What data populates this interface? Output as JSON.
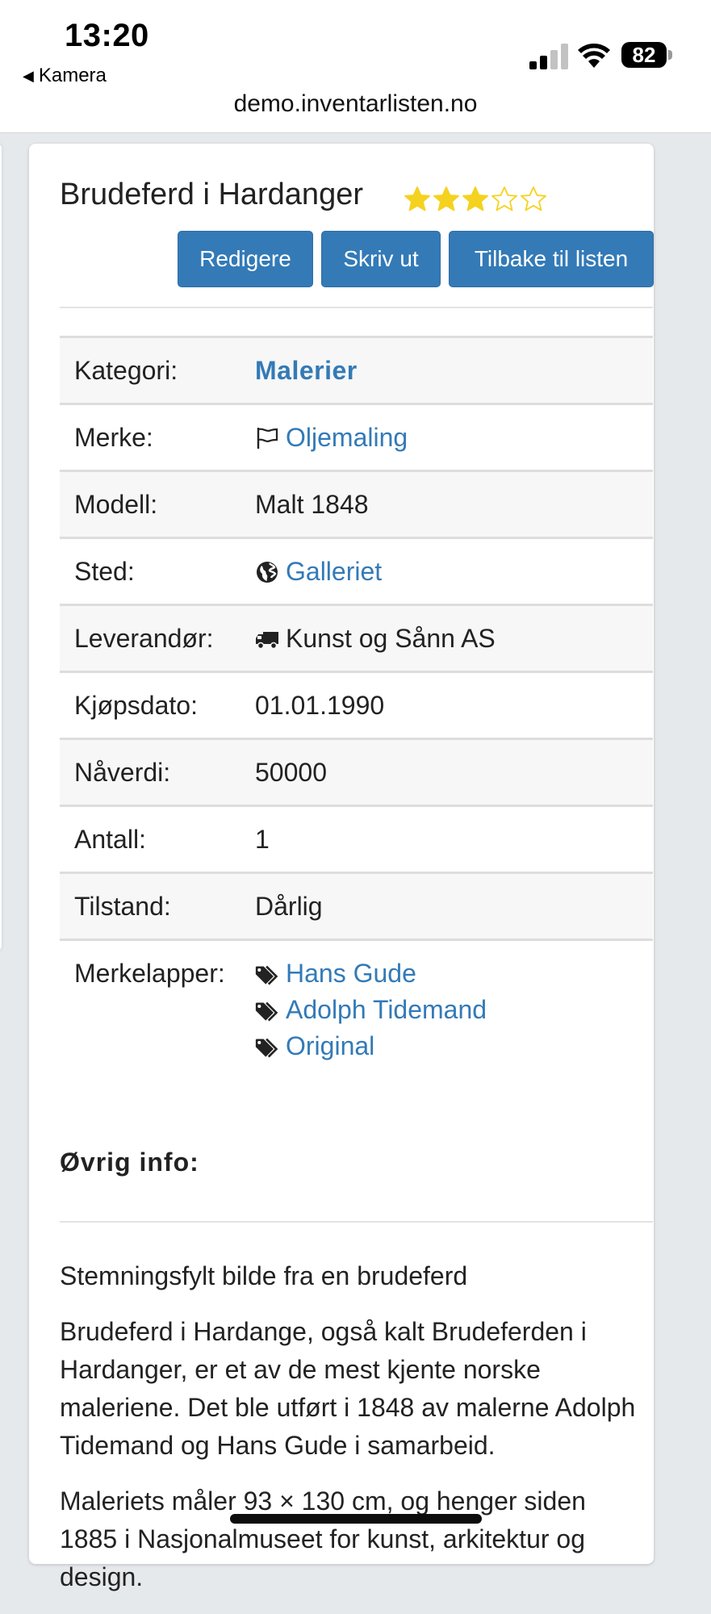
{
  "status": {
    "time": "13:20",
    "back_app": "Kamera",
    "battery": "82",
    "url": "demo.inventarlisten.no"
  },
  "item": {
    "title": "Brudeferd i Hardanger",
    "rating": 3,
    "rating_max": 5,
    "buttons": {
      "edit": "Redigere",
      "print": "Skriv ut",
      "back": "Tilbake til listen"
    },
    "fields": {
      "category": {
        "label": "Kategori:",
        "value": "Malerier"
      },
      "brand": {
        "label": "Merke:",
        "value": "Oljemaling",
        "icon": "flag-icon"
      },
      "model": {
        "label": "Modell:",
        "value": "Malt 1848"
      },
      "location": {
        "label": "Sted:",
        "value": "Galleriet",
        "icon": "globe-icon"
      },
      "supplier": {
        "label": "Leverandør:",
        "value": "Kunst og Sånn AS",
        "icon": "truck-icon"
      },
      "purchase_date": {
        "label": "Kjøpsdato:",
        "value": "01.01.1990"
      },
      "current_value": {
        "label": "Nåverdi:",
        "value": "50000"
      },
      "quantity": {
        "label": "Antall:",
        "value": "1"
      },
      "condition": {
        "label": "Tilstand:",
        "value": "Dårlig"
      },
      "tags": {
        "label": "Merkelapper:",
        "values": [
          "Hans Gude",
          "Adolph Tidemand",
          "Original"
        ],
        "icon": "tags-icon"
      }
    },
    "other_info": {
      "heading": "Øvrig info:",
      "paragraphs": [
        "Stemningsfylt bilde fra en brudeferd",
        "Brudeferd i Hardange, også kalt Brudeferden i Hardanger, er et av de mest kjente norske maleriene. Det ble utført i 1848 av malerne Adolph Tidemand og Hans Gude i samarbeid.",
        "Maleriets måler 93 × 130 cm, og henger siden 1885 i Nasjonalmuseet for kunst, arkitektur og design."
      ]
    }
  },
  "colors": {
    "link": "#337ab7",
    "button": "#337ab7",
    "star": "#f5d21f"
  }
}
